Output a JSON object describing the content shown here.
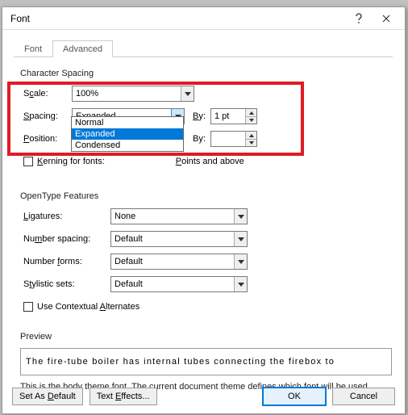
{
  "window": {
    "title": "Font"
  },
  "tabs": {
    "font": "Font",
    "advanced": "Advanced"
  },
  "char_spacing": {
    "group": "Character Spacing",
    "scale_label_pre": "S",
    "scale_label_ul": "c",
    "scale_label_post": "ale:",
    "scale_value": "100%",
    "spacing_label_pre": "",
    "spacing_label_ul": "S",
    "spacing_label_post": "pacing:",
    "spacing_value": "Expanded",
    "spacing_by_label_ul": "B",
    "spacing_by_label_post": "y:",
    "spacing_by_value": "1 pt",
    "position_label_pre": "",
    "position_label_ul": "P",
    "position_label_post": "osition:",
    "position_value": "",
    "position_by_label_post": "y:",
    "position_by_value": "",
    "kerning_label_pre": "",
    "kerning_label_ul": "K",
    "kerning_label_post": "erning for fonts:",
    "kerning_suffix_pre": "",
    "kerning_suffix_ul": "P",
    "kerning_suffix_post": "oints and above"
  },
  "dropdown": {
    "options": {
      "0": "Normal",
      "1": "Expanded",
      "2": "Condensed"
    }
  },
  "opentype": {
    "group": "OpenType Features",
    "ligatures_ul": "L",
    "ligatures_post": "igatures:",
    "ligatures_value": "None",
    "numsp_pre": "Nu",
    "numsp_ul": "m",
    "numsp_post": "ber spacing:",
    "numsp_value": "Default",
    "numfm_pre": "Number ",
    "numfm_ul": "f",
    "numfm_post": "orms:",
    "numfm_value": "Default",
    "sty_pre": "S",
    "sty_ul": "t",
    "sty_post": "ylistic sets:",
    "sty_value": "Default",
    "contextual_pre": "Use Contextual ",
    "contextual_ul": "A",
    "contextual_post": "lternates"
  },
  "preview": {
    "label": "Preview",
    "text": "The fire-tube boiler has internal tubes connecting the firebox to",
    "help": "This is the body theme font. The current document theme defines which font will be used."
  },
  "footer": {
    "set_default_pre": "Set As ",
    "set_default_ul": "D",
    "set_default_post": "efault",
    "text_effects_pre": "Text ",
    "text_effects_ul": "E",
    "text_effects_post": "ffects...",
    "ok": "OK",
    "cancel": "Cancel"
  }
}
